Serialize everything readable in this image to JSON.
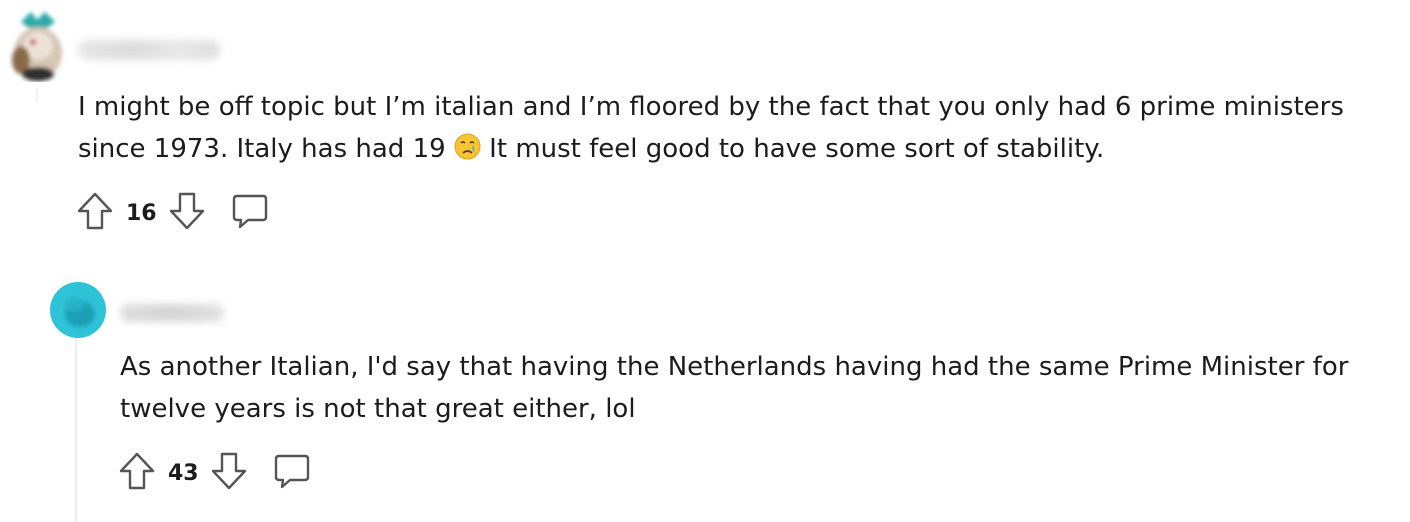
{
  "comments": [
    {
      "username": "",
      "text_before_emoji": "I might be off topic but I’m italian and I’m floored by the fact that you only had 6 prime ministers since 1973. Italy has had 19 ",
      "emoji": "crying-face-emoji",
      "text_after_emoji": " It must feel good to have some sort of stability.",
      "score": "16"
    },
    {
      "username": "",
      "text": "As another Italian, I'd say that having the Netherlands having had the same Prime Minister for twelve years is not that great either, lol",
      "score": "43"
    }
  ],
  "icons": {
    "upvote": "arrow-up-icon",
    "downvote": "arrow-down-icon",
    "reply": "speech-bubble-icon"
  },
  "colors": {
    "avatar2_accent": "#2fc3d8",
    "text": "#1c1c1c",
    "icon_stroke": "#555555"
  }
}
